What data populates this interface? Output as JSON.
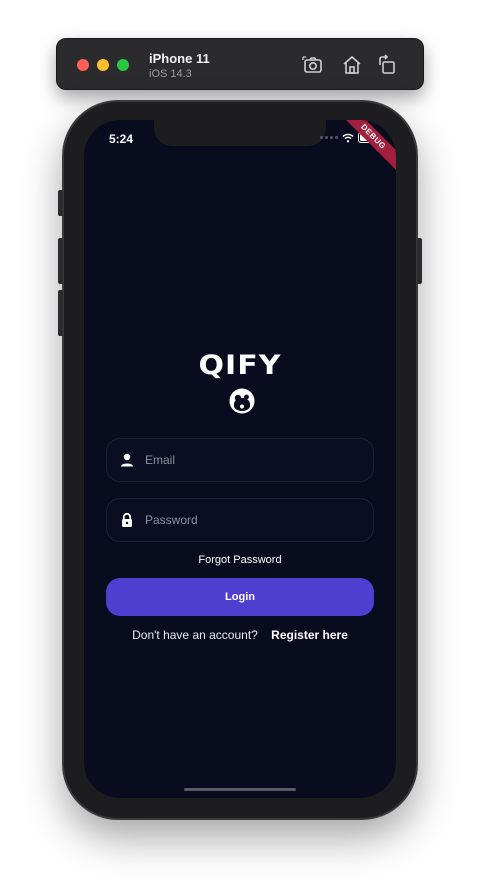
{
  "simulator": {
    "device": "iPhone 11",
    "os": "iOS 14.3",
    "icons": [
      "screenshot-icon",
      "home-icon",
      "rotate-icon"
    ]
  },
  "status_bar": {
    "time": "5:24",
    "debug_label": "DEBUG"
  },
  "app": {
    "logo_text": "QIFY",
    "email": {
      "placeholder": "Email",
      "value": "",
      "icon": "person-icon"
    },
    "password": {
      "placeholder": "Password",
      "value": "",
      "icon": "lock-icon"
    },
    "forgot_label": "Forgot Password",
    "login_label": "Login",
    "register_question": "Don't have an account?",
    "register_link": "Register here"
  },
  "colors": {
    "background": "#090c1f",
    "accent": "#4f3fd1",
    "field_border": "#1e2235",
    "debug_banner": "#a21f3e"
  }
}
